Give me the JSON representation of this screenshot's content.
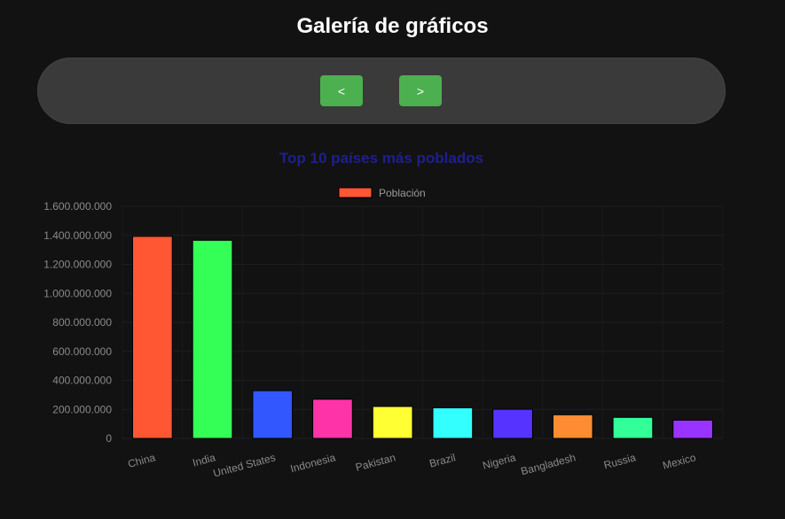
{
  "page": {
    "title": "Galería de gráficos"
  },
  "nav": {
    "prev_label": "<",
    "next_label": ">"
  },
  "chart_data": {
    "type": "bar",
    "title": "Top 10 países más poblados",
    "categories": [
      "China",
      "India",
      "United States",
      "Indonesia",
      "Pakistan",
      "Brazil",
      "Nigeria",
      "Bangladesh",
      "Russia",
      "Mexico"
    ],
    "series": [
      {
        "name": "Población",
        "values": [
          1393000000,
          1366000000,
          329000000,
          270000000,
          220000000,
          211000000,
          201000000,
          163000000,
          145000000,
          126000000
        ]
      }
    ],
    "colors": [
      "#ff5733",
      "#33ff57",
      "#3357ff",
      "#ff33a8",
      "#ffff33",
      "#33ffff",
      "#5733ff",
      "#ff8c33",
      "#33ff99",
      "#9933ff"
    ],
    "legend_color": "#ff5733",
    "ylim": [
      0,
      1600000000
    ],
    "yticks": [
      0,
      200000000,
      400000000,
      600000000,
      800000000,
      1000000000,
      1200000000,
      1400000000,
      1600000000
    ],
    "ytick_labels": [
      "0",
      "200.000.000",
      "400.000.000",
      "600.000.000",
      "800.000.000",
      "1.000.000.000",
      "1.200.000.000",
      "1.400.000.000",
      "1.600.000.000"
    ],
    "legend_position": "top",
    "grid": true
  }
}
